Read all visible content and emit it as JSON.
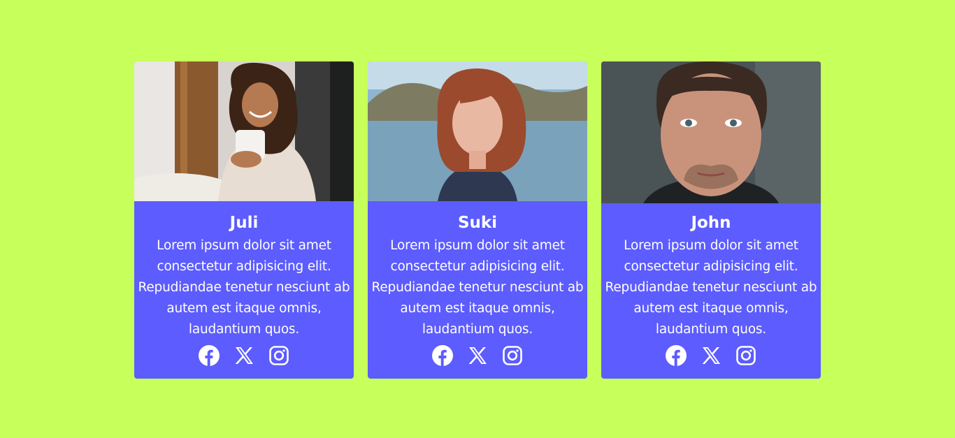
{
  "colors": {
    "background": "#c7ff5b",
    "card": "#5c5cff",
    "text": "#ffffff"
  },
  "cards": [
    {
      "name": "Juli",
      "bio": "Lorem ipsum dolor sit amet consectetur adipisicing elit. Repudiandae tenetur nesciunt ab autem est itaque omnis, laudantium quos.",
      "social": [
        "facebook-icon",
        "x-icon",
        "instagram-icon"
      ]
    },
    {
      "name": "Suki",
      "bio": "Lorem ipsum dolor sit amet consectetur adipisicing elit. Repudiandae tenetur nesciunt ab autem est itaque omnis, laudantium quos.",
      "social": [
        "facebook-icon",
        "x-icon",
        "instagram-icon"
      ]
    },
    {
      "name": "John",
      "bio": "Lorem ipsum dolor sit amet consectetur adipisicing elit. Repudiandae tenetur nesciunt ab autem est itaque omnis, laudantium quos.",
      "social": [
        "facebook-icon",
        "x-icon",
        "instagram-icon"
      ]
    }
  ]
}
